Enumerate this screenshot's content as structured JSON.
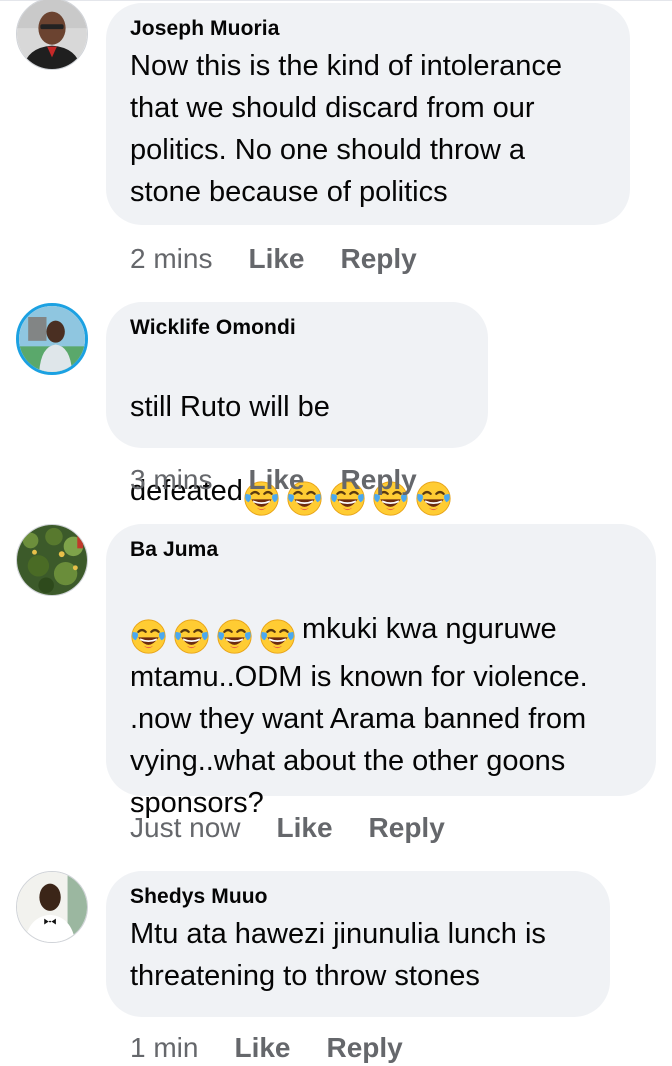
{
  "comments": [
    {
      "author": "Joseph Muoria",
      "text": "Now this is the kind of intolerance\nthat we should discard from our\npolitics. No one should throw a\nstone because of politics",
      "time": "2 mins",
      "like_label": "Like",
      "reply_label": "Reply"
    },
    {
      "author": "Wicklife Omondi",
      "text_line1": "still Ruto will be",
      "text_line2": "defeated",
      "emoji_count": 5,
      "time": "3 mins",
      "like_label": "Like",
      "reply_label": "Reply"
    },
    {
      "author": "Ba Juma",
      "text_lead": "mkuki kwa nguruwe",
      "text_rest": "mtamu..ODM is known for violence.\n.now they want Arama banned from\nvying..what about the other goons\nsponsors?",
      "emoji_count": 4,
      "time": "Just now",
      "like_label": "Like",
      "reply_label": "Reply"
    },
    {
      "author": "Shedys Muuo",
      "text": "Mtu ata hawezi jinunulia lunch is\nthreatening to throw stones",
      "time": "1 min",
      "like_label": "Like",
      "reply_label": "Reply"
    }
  ],
  "emoji": "face-with-tears-of-joy-icon",
  "colors": {
    "bubble": "#f0f2f5",
    "meta_text": "#65676b",
    "body_text": "#050505"
  }
}
